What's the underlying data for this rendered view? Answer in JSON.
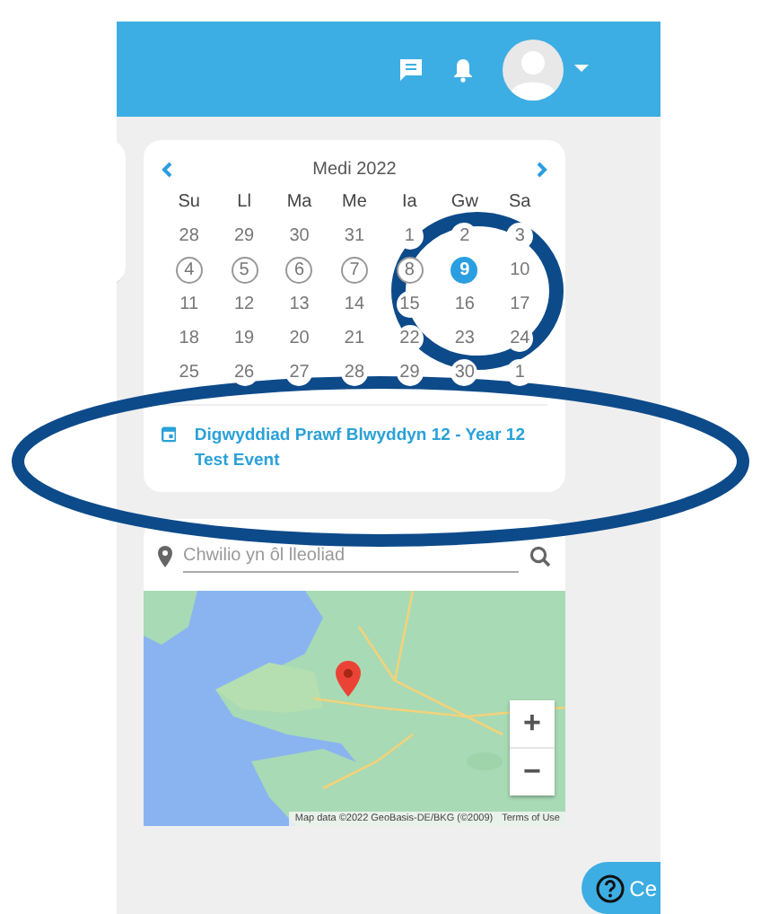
{
  "calendar": {
    "month": "Medi 2022",
    "weekdays": [
      "Su",
      "Ll",
      "Ma",
      "Me",
      "Ia",
      "Gw",
      "Sa"
    ],
    "weeks": [
      [
        {
          "day": "28",
          "marked": false,
          "selected": false
        },
        {
          "day": "29",
          "marked": false,
          "selected": false
        },
        {
          "day": "30",
          "marked": false,
          "selected": false
        },
        {
          "day": "31",
          "marked": false,
          "selected": false
        },
        {
          "day": "1",
          "marked": false,
          "selected": false
        },
        {
          "day": "2",
          "marked": false,
          "selected": false
        },
        {
          "day": "3",
          "marked": false,
          "selected": false
        }
      ],
      [
        {
          "day": "4",
          "marked": true,
          "selected": false
        },
        {
          "day": "5",
          "marked": true,
          "selected": false
        },
        {
          "day": "6",
          "marked": true,
          "selected": false
        },
        {
          "day": "7",
          "marked": true,
          "selected": false
        },
        {
          "day": "8",
          "marked": true,
          "selected": false
        },
        {
          "day": "9",
          "marked": false,
          "selected": true
        },
        {
          "day": "10",
          "marked": false,
          "selected": false
        }
      ],
      [
        {
          "day": "11",
          "marked": false,
          "selected": false
        },
        {
          "day": "12",
          "marked": false,
          "selected": false
        },
        {
          "day": "13",
          "marked": false,
          "selected": false
        },
        {
          "day": "14",
          "marked": false,
          "selected": false
        },
        {
          "day": "15",
          "marked": false,
          "selected": false
        },
        {
          "day": "16",
          "marked": false,
          "selected": false
        },
        {
          "day": "17",
          "marked": false,
          "selected": false
        }
      ],
      [
        {
          "day": "18",
          "marked": false,
          "selected": false
        },
        {
          "day": "19",
          "marked": false,
          "selected": false
        },
        {
          "day": "20",
          "marked": false,
          "selected": false
        },
        {
          "day": "21",
          "marked": false,
          "selected": false
        },
        {
          "day": "22",
          "marked": false,
          "selected": false
        },
        {
          "day": "23",
          "marked": false,
          "selected": false
        },
        {
          "day": "24",
          "marked": false,
          "selected": false
        }
      ],
      [
        {
          "day": "25",
          "marked": false,
          "selected": false
        },
        {
          "day": "26",
          "marked": false,
          "selected": false
        },
        {
          "day": "27",
          "marked": false,
          "selected": false
        },
        {
          "day": "28",
          "marked": false,
          "selected": false
        },
        {
          "day": "29",
          "marked": false,
          "selected": false
        },
        {
          "day": "30",
          "marked": false,
          "selected": false
        },
        {
          "day": "1",
          "marked": false,
          "selected": false
        }
      ]
    ],
    "event": {
      "title": "Digwyddiad Prawf Blwyddyn 12 - Year 12 Test Event"
    }
  },
  "location_search": {
    "placeholder": "Chwilio yn ôl lleoliad"
  },
  "map": {
    "kind": "picture",
    "zoom_in": "+",
    "zoom_out": "−",
    "attribution": "Map data ©2022 GeoBasis-DE/BKG (©2009)",
    "terms": "Terms of Use"
  },
  "help_button": {
    "label": "Ce"
  }
}
